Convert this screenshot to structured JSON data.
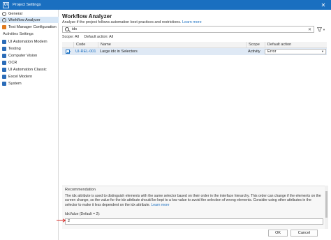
{
  "window": {
    "title": "Project Settings",
    "app_icon_glyph": "Ui",
    "close_glyph": "✕"
  },
  "sidebar": {
    "items_top": [
      {
        "label": "General",
        "icon": "gear-icon"
      },
      {
        "label": "Workflow Analyzer",
        "icon": "analyzer-icon",
        "selected": true
      },
      {
        "label": "Test Manager Configuration",
        "icon": "test-manager-icon"
      }
    ],
    "section_label": "Activities Settings",
    "items_activities": [
      {
        "label": "UI Automation Modern"
      },
      {
        "label": "Testing"
      },
      {
        "label": "Computer Vision"
      },
      {
        "label": "OCR"
      },
      {
        "label": "UI Automation Classic"
      },
      {
        "label": "Excel Modern"
      },
      {
        "label": "System"
      }
    ]
  },
  "main": {
    "title": "Workflow Analyzer",
    "subtitle": "Analyze if the project follows automation best practices and restrictions.",
    "learn_more": "Learn more",
    "search": {
      "value": "idx",
      "clear_glyph": "✕"
    },
    "filter_icon": "funnel-icon",
    "scope_label": "Scope: All",
    "default_action_label": "Default action: All",
    "table": {
      "headers": {
        "code": "Code",
        "name": "Name",
        "scope": "Scope",
        "default_action": "Default action"
      },
      "rows": [
        {
          "checked": true,
          "code": "UI-REL-001",
          "name": "Large idx in Selectors",
          "scope": "Activity",
          "default_action": "Error"
        }
      ]
    },
    "recommendation": {
      "title": "Recommendation",
      "text": "The idx attribute is used to distinguish elements with the same selector based on their order in the interface hierarchy. This order can change if the elements on the screen change, so the value for the idx attribute should be kept to a low value to avoid the selection of wrong elements. Consider using other attributes in the selector to make it less dependent on the idx attribute.",
      "learn_more": "Learn more",
      "param_label": "IdxValue (Default = 2):",
      "param_value": "2"
    }
  },
  "buttons": {
    "ok": "OK",
    "cancel": "Cancel"
  },
  "colors": {
    "accent": "#1a6fc0",
    "selection": "#d6e6f6",
    "row_selected": "#dfe9f5",
    "arrow": "#d9302c"
  }
}
